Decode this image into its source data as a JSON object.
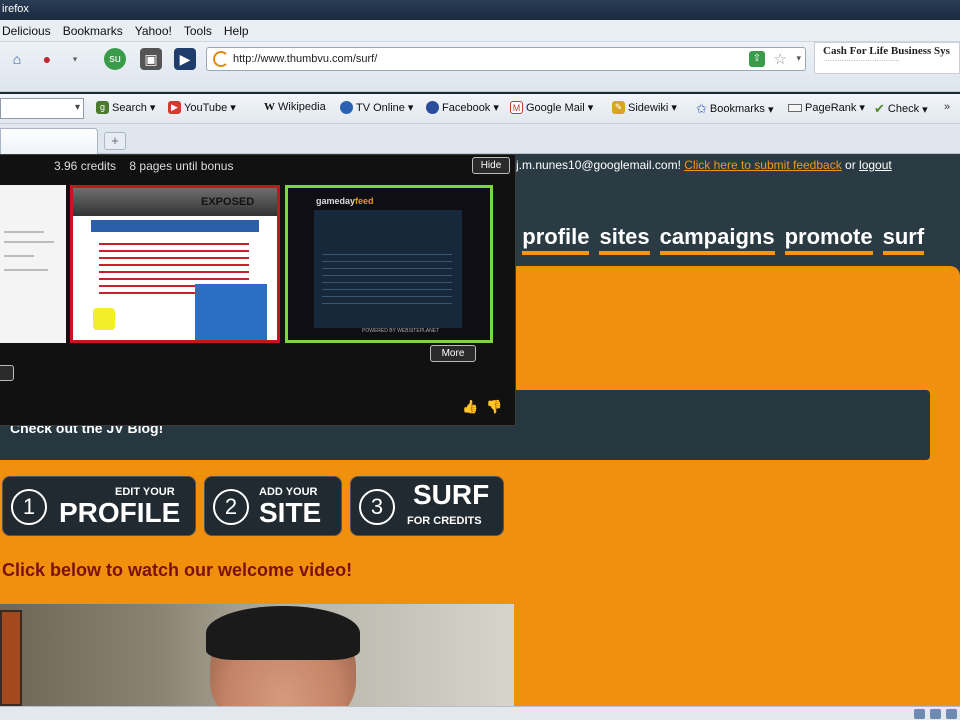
{
  "window": {
    "title_fragment": "irefox"
  },
  "menu": [
    "Delicious",
    "Bookmarks",
    "Yahoo!",
    "Tools",
    "Help"
  ],
  "navbar": {
    "url": "http://www.thumbvu.com/surf/",
    "ad_title": "Cash For Life Business Sys"
  },
  "bookmarks": {
    "items": [
      {
        "label": "Search",
        "icon": "search-icon",
        "color": "#4a7a2c"
      },
      {
        "label": "YouTube",
        "icon": "youtube-icon",
        "color": "#d13b2c"
      },
      {
        "label": "Wikipedia",
        "icon": "wikipedia-icon",
        "color": "#222222"
      },
      {
        "label": "TV Online",
        "icon": "tv-icon",
        "color": "#2a62b3"
      },
      {
        "label": "Facebook",
        "icon": "facebook-icon",
        "color": "#2a4c9b"
      },
      {
        "label": "Google Mail",
        "icon": "gmail-icon",
        "color": "#c23b2e"
      },
      {
        "label": "Sidewiki",
        "icon": "sidewiki-icon",
        "color": "#d8a520"
      },
      {
        "label": "Bookmarks",
        "icon": "star-icon",
        "color": "#2f5fb8"
      },
      {
        "label": "PageRank",
        "icon": "pagerank-icon",
        "color": "#6a6a6a"
      },
      {
        "label": "Check",
        "icon": "check-icon",
        "color": "#4d8b2e"
      }
    ]
  },
  "tabs": {
    "new_tab": "+"
  },
  "page": {
    "user_text": "j.m.nunes10@googlemail.com!",
    "feedback_link": "Click here to submit feedback",
    "or_text": "or",
    "logout_link": "logout",
    "nav_fragment": "e",
    "nav": [
      "profile",
      "sites",
      "campaigns",
      "promote",
      "surf"
    ],
    "blog_text": "Check out the JV Blog!",
    "steps": [
      {
        "num": "1",
        "small": "EDIT YOUR",
        "big": "PROFILE"
      },
      {
        "num": "2",
        "small": "ADD YOUR",
        "big": "SITE"
      },
      {
        "num": "3",
        "big": "SURF",
        "small": "FOR CREDITS"
      }
    ],
    "welcome": "Click below to watch our welcome video!"
  },
  "overlay": {
    "credits": "3.96 credits",
    "bonus": "8 pages until bonus",
    "hide": "Hide",
    "more": "More",
    "thumb2_title": "EXPOSED",
    "thumb3_title_a": "gameday",
    "thumb3_title_b": "feed",
    "thumb3_footer": "POWERED BY WEBSITEPLANET"
  },
  "colors": {
    "accent_orange": "#f0900d",
    "dark_bg": "#2b3b44",
    "thumb_red": "#c4161c",
    "thumb_green": "#7cd64a"
  }
}
